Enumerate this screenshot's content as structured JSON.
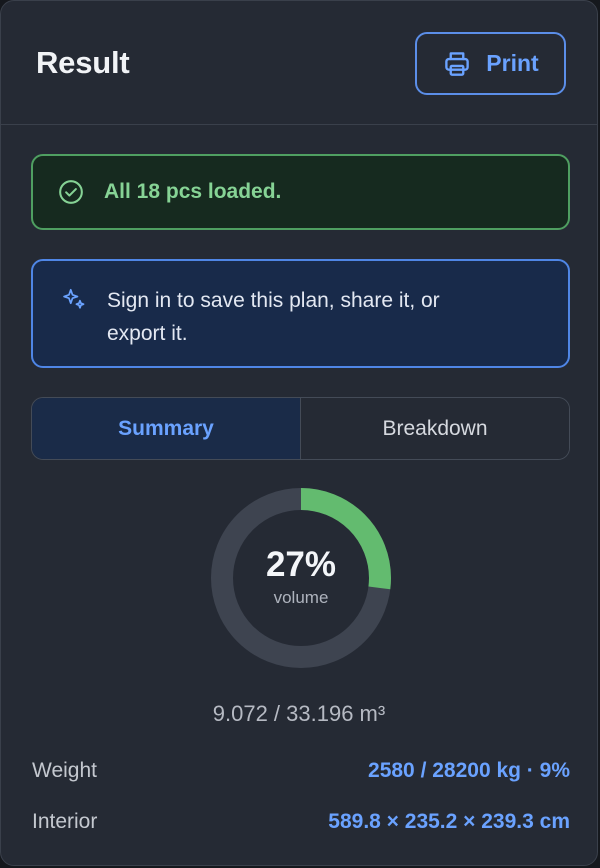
{
  "header": {
    "title": "Result",
    "print_label": "Print"
  },
  "alerts": {
    "success": "All 18 pcs loaded.",
    "info": "Sign in to save this plan, share it, or export it."
  },
  "tabs": [
    {
      "label": "Summary",
      "active": true
    },
    {
      "label": "Breakdown",
      "active": false
    }
  ],
  "volume": {
    "percent": 27,
    "percent_text": "27%",
    "label": "volume",
    "used_text": "9.072 / 33.196 m³"
  },
  "stats": {
    "weight": {
      "label": "Weight",
      "value": "2580 / 28200 kg · 9%"
    },
    "interior": {
      "label": "Interior",
      "value": "589.8 × 235.2 × 239.3 cm"
    }
  },
  "colors": {
    "panel_bg": "#252a34",
    "accent_blue": "#6aa2ff",
    "success_green": "#86d395",
    "donut_fill": "#63bb6f",
    "donut_track": "#3e4450"
  },
  "icons": {
    "print": "printer-icon",
    "success": "check-circle-icon",
    "info": "sparkles-icon"
  }
}
